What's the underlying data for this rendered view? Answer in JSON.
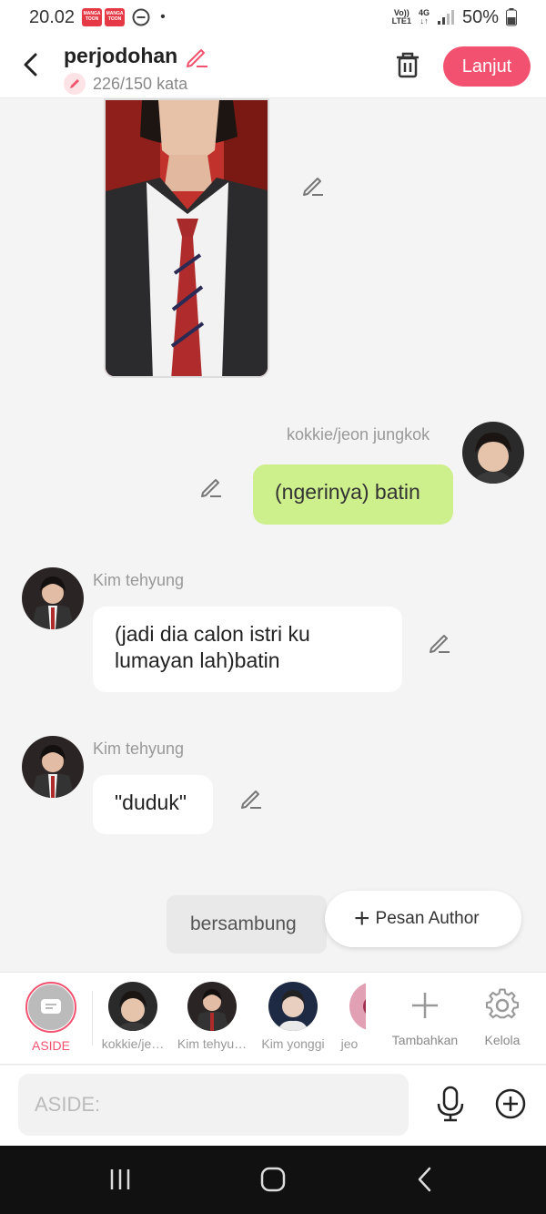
{
  "status_bar": {
    "time": "20.02",
    "app_badge_text": "MANGA TOON",
    "network_top": "Vo))",
    "network_bottom": "LTE1",
    "network_type": "4G",
    "battery": "50%"
  },
  "header": {
    "title": "perjodohan",
    "word_count": "226/150 kata",
    "next_label": "Lanjut"
  },
  "messages": [
    {
      "side": "right",
      "sender": "kokkie/jeon jungkok",
      "text": "(ngerinya) batin"
    },
    {
      "side": "left",
      "sender": "Kim tehyung",
      "text": "(jadi dia calon istri ku lumayan lah)batin"
    },
    {
      "side": "left",
      "sender": "Kim tehyung",
      "text": "\"duduk\""
    }
  ],
  "continue_label": "bersambung",
  "author_message_label": "Pesan Author",
  "characters": [
    {
      "label": "ASIDE"
    },
    {
      "label": "kokkie/je…"
    },
    {
      "label": "Kim tehyu…"
    },
    {
      "label": "Kim yonggi"
    },
    {
      "label": "jeo"
    }
  ],
  "tools": {
    "add_label": "Tambahkan",
    "manage_label": "Kelola"
  },
  "input": {
    "placeholder": "ASIDE:"
  },
  "colors": {
    "accent": "#f2526f",
    "right_bubble": "#cdef8c",
    "left_bubble": "#ffffff",
    "background": "#f4f4f4"
  }
}
